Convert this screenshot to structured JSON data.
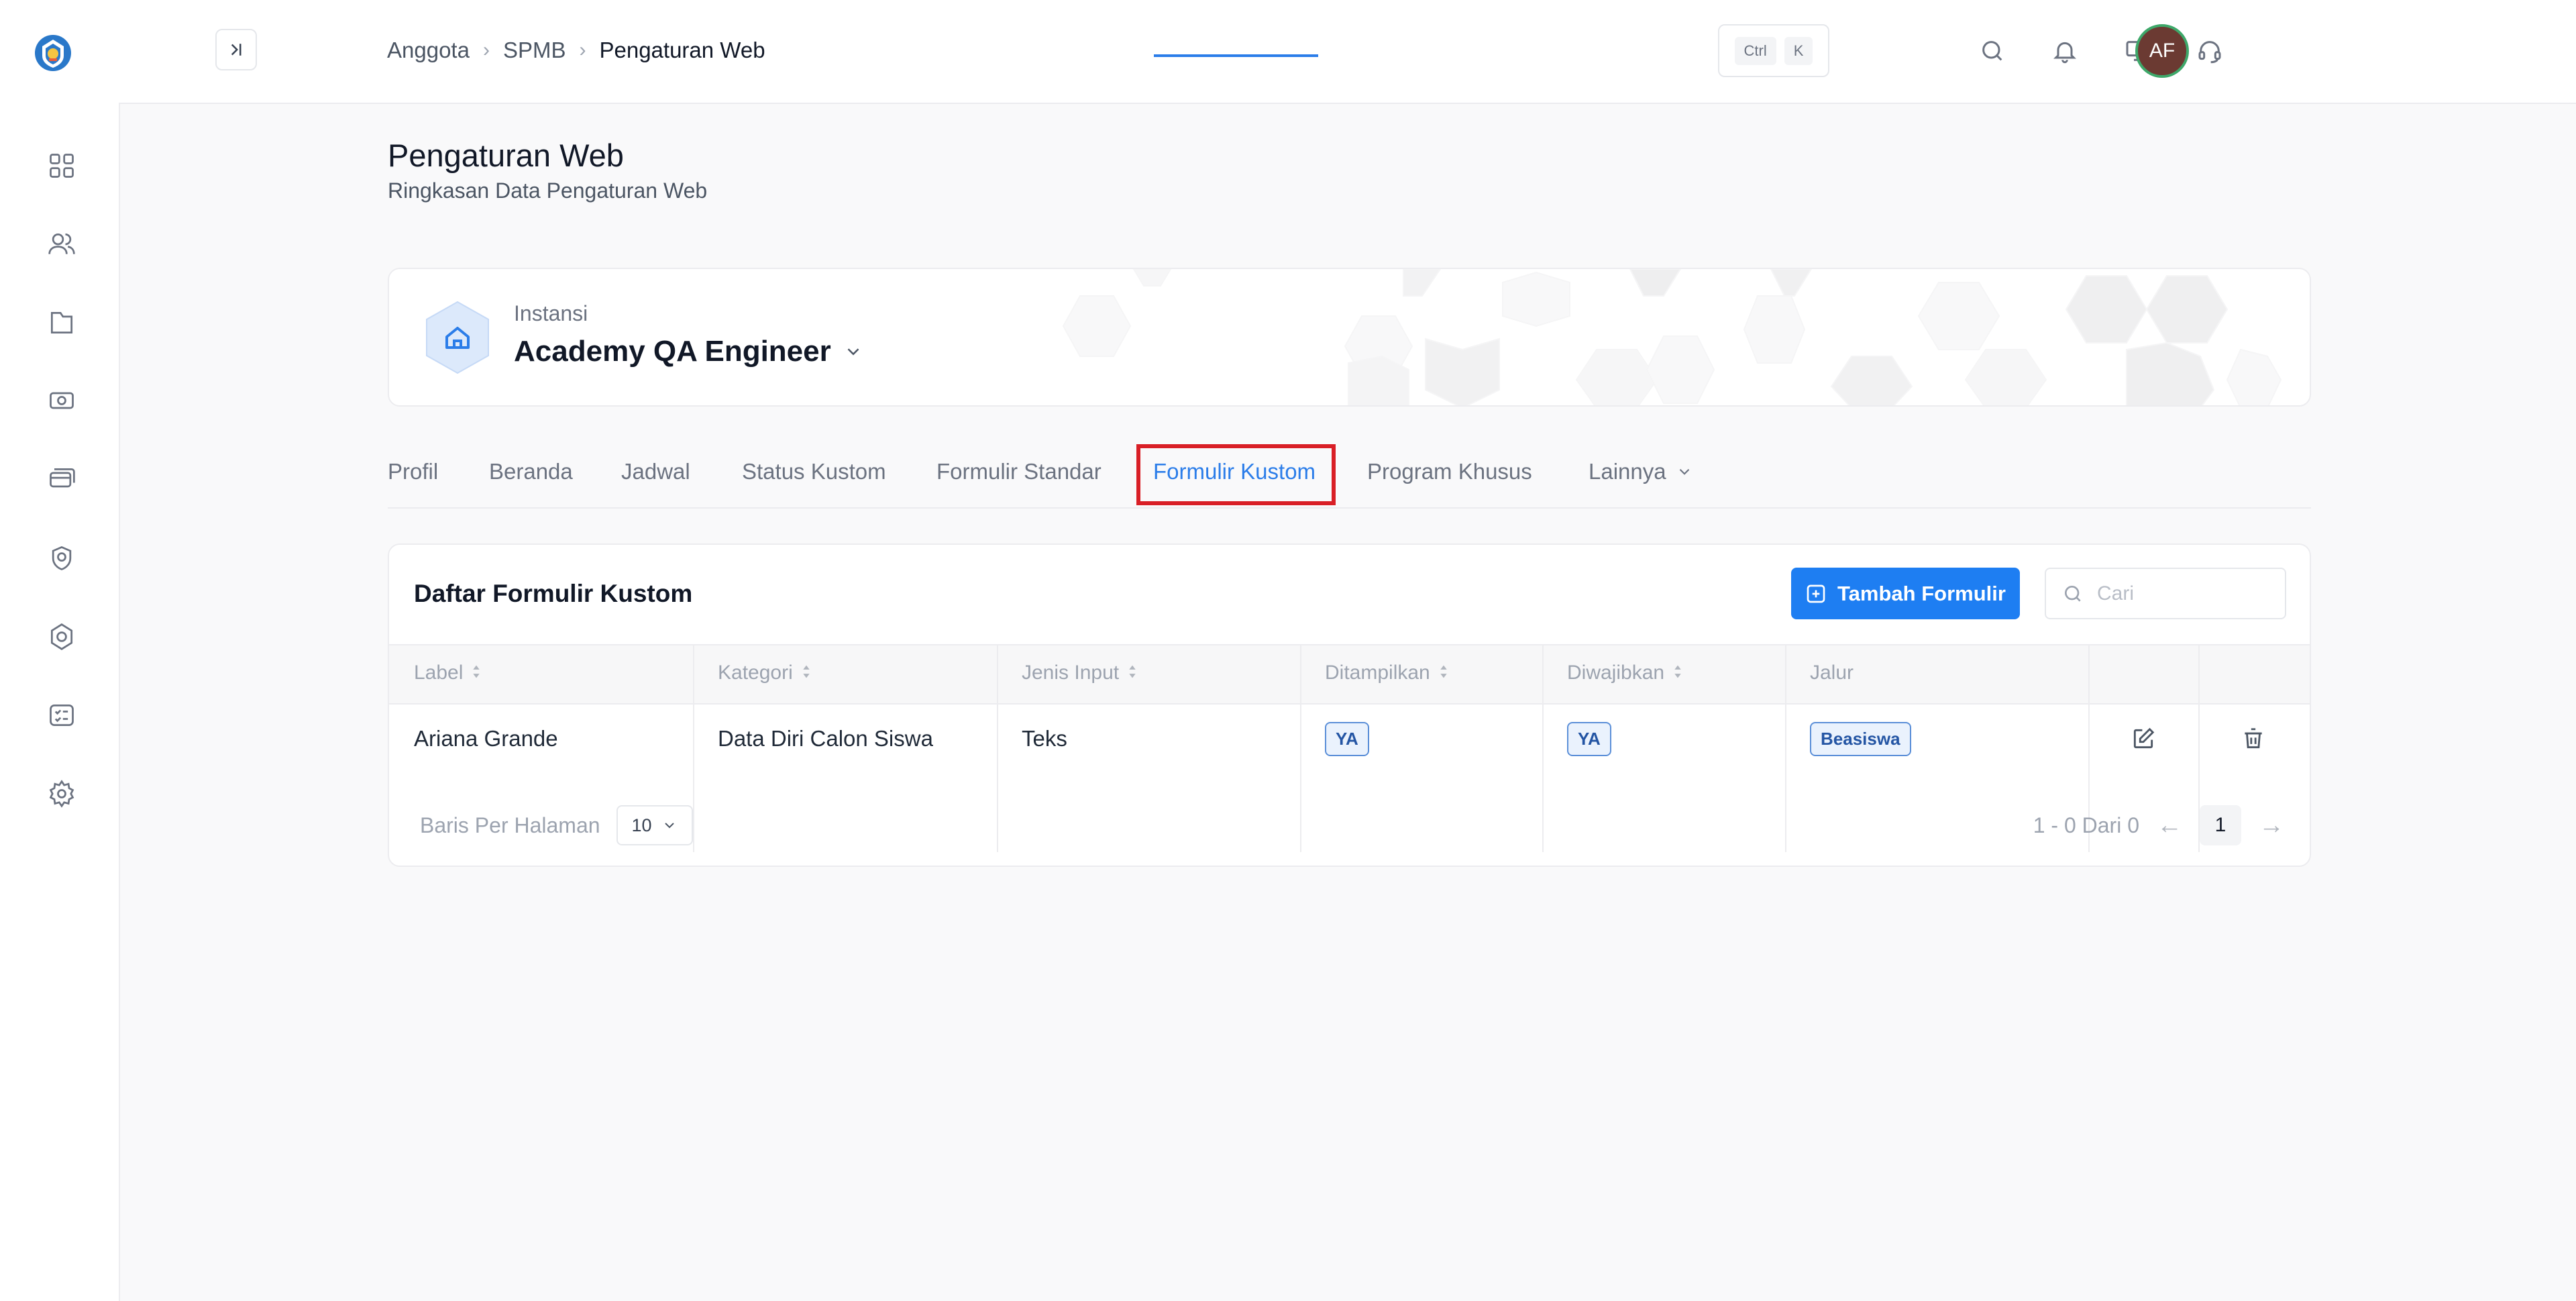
{
  "breadcrumb": [
    "Anggota",
    "SPMB",
    "Pengaturan Web"
  ],
  "shortcut": {
    "ctrl": "Ctrl",
    "key": "K"
  },
  "user": {
    "initials": "AF"
  },
  "page": {
    "title": "Pengaturan Web",
    "subtitle": "Ringkasan Data Pengaturan Web"
  },
  "instance": {
    "label": "Instansi",
    "name": "Academy QA Engineer"
  },
  "tabs": [
    {
      "label": "Profil"
    },
    {
      "label": "Beranda"
    },
    {
      "label": "Jadwal"
    },
    {
      "label": "Status Kustom"
    },
    {
      "label": "Formulir Standar"
    },
    {
      "label": "Formulir Kustom",
      "active": true
    },
    {
      "label": "Program Khusus"
    },
    {
      "label": "Lainnya"
    }
  ],
  "table": {
    "title": "Daftar Formulir Kustom",
    "add_button": "Tambah Formulir",
    "search_placeholder": "Cari",
    "columns": [
      "Label",
      "Kategori",
      "Jenis Input",
      "Ditampilkan",
      "Diwajibkan",
      "Jalur"
    ],
    "rows": [
      {
        "label": "Ariana Grande",
        "kategori": "Data Diri Calon Siswa",
        "jenis_input": "Teks",
        "ditampilkan": "YA",
        "diwajibkan": "YA",
        "jalur": "Beasiswa"
      }
    ]
  },
  "pagination": {
    "rows_per_page_label": "Baris Per Halaman",
    "rows_per_page": "10",
    "range": "1 - 0 Dari 0",
    "current_page": "1"
  },
  "colors": {
    "accent": "#1e7ef2",
    "highlight": "#d91f26",
    "avatar": "#6b3a32"
  }
}
